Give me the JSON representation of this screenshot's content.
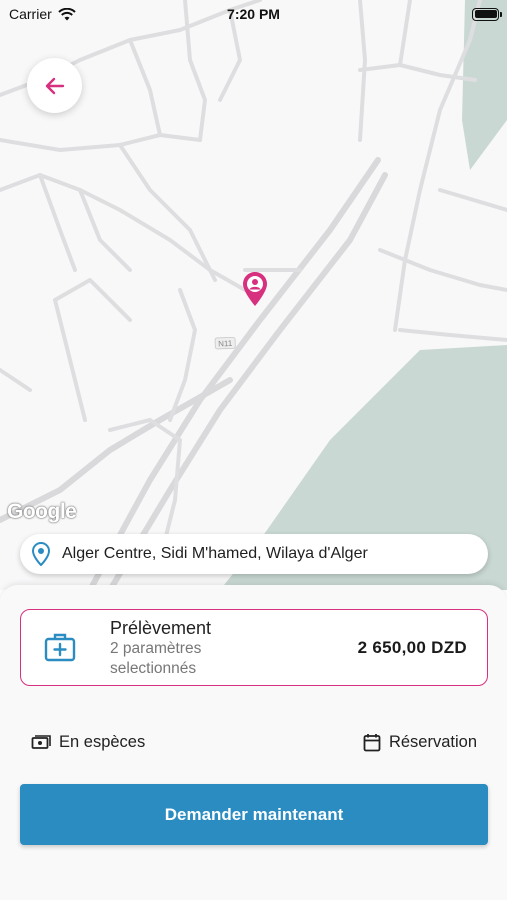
{
  "status_bar": {
    "carrier": "Carrier",
    "time": "7:20 PM"
  },
  "map": {
    "road_label": "N11",
    "attribution": "Google",
    "pin_color": "#d6307f"
  },
  "address": {
    "text": "Alger Centre, Sidi M'hamed, Wilaya d'Alger"
  },
  "service": {
    "title": "Prélèvement",
    "subtitle_line1": "2 paramètres",
    "subtitle_line2": "selectionnés",
    "price": "2 650,00 DZD"
  },
  "payment": {
    "label": "En espèces",
    "icon": "cash-icon"
  },
  "reservation": {
    "label": "Réservation",
    "icon": "calendar-icon"
  },
  "request_button": {
    "label": "Demander maintenant"
  },
  "colors": {
    "accent_pink": "#d6307f",
    "primary_blue": "#2a8cc1",
    "icon_blue": "#2a8cc1",
    "water": "#c9d8d3"
  }
}
